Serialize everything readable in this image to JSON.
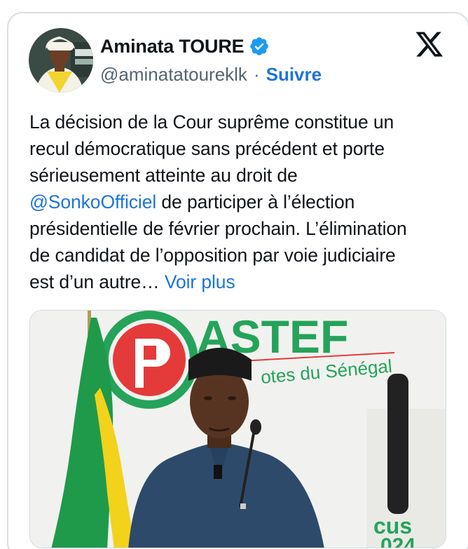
{
  "author": {
    "display_name": "Aminata TOURE",
    "handle": "@aminatatoureklk",
    "separator": "·",
    "follow_label": "Suivre",
    "verified": true,
    "avatar_icon": "profile-photo"
  },
  "platform": {
    "logo_icon": "x-logo-icon"
  },
  "tweet": {
    "line1": "La décision de la Cour suprême  constitue un",
    "line2": "recul démocratique sans précédent et porte",
    "line3": "sérieusement atteinte au droit de",
    "mention": "@SonkoOfficiel",
    "line4_rest": " de participer à l’élection",
    "line5": "présidentielle de février prochain. L’élimination",
    "line6": "de candidat de l’opposition par voie judiciaire",
    "line7": "est d’un autre…",
    "read_more": "Voir plus"
  },
  "media": {
    "banner_text": "ASTEF",
    "banner_subtext": "otes du Sénégal",
    "corner_text": "cus",
    "corner_subtext": "024",
    "colors": {
      "green": "#25a35a",
      "red": "#e53a3a",
      "flag_green": "#1f9a4a",
      "flag_yellow": "#f2d21b",
      "suit": "#2d4a6a"
    }
  },
  "colors": {
    "link": "#1d74d8",
    "text": "#0f1419",
    "secondary": "#536471",
    "verified": "#1d9bf0",
    "card_border": "#d7dde3"
  }
}
